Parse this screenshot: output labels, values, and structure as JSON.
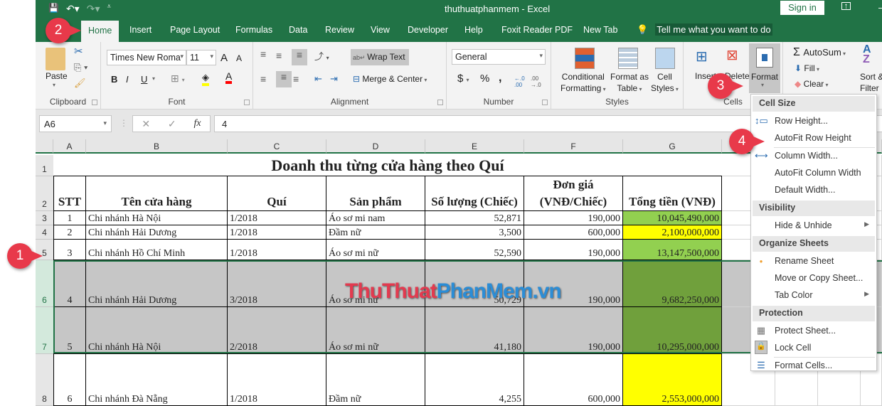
{
  "window": {
    "title": "thuthuatphanmem  -  Excel",
    "sign_in": "Sign in"
  },
  "qat": {
    "save": "💾",
    "undo": "↶▾",
    "redo": "↷▾",
    "customize": "⩡"
  },
  "tabs": [
    "Home",
    "Insert",
    "Page Layout",
    "Formulas",
    "Data",
    "Review",
    "View",
    "Developer",
    "Help",
    "Foxit Reader PDF",
    "New Tab"
  ],
  "tell_me": "Tell me what you want to do",
  "ribbon": {
    "clipboard": {
      "label": "Clipboard",
      "paste": "Paste"
    },
    "font": {
      "label": "Font",
      "font_name": "Times New Roma",
      "font_size": "11",
      "bold": "B",
      "italic": "I",
      "underline": "U",
      "grow": "A",
      "shrink": "A"
    },
    "alignment": {
      "label": "Alignment",
      "wrap_text": "Wrap Text",
      "merge_center": "Merge & Center"
    },
    "number": {
      "label": "Number",
      "format": "General",
      "currency": "$",
      "percent": "%",
      "comma": ",",
      "inc_dec": "←.0 .00",
      "dec_dec": ".00 →.0"
    },
    "styles": {
      "label": "Styles",
      "conditional": "Conditional",
      "conditional2": "Formatting",
      "format_table": "Format as",
      "format_table2": "Table",
      "cell_styles": "Cell",
      "cell_styles2": "Styles"
    },
    "cells": {
      "label": "Cells",
      "insert": "Insert",
      "delete": "Delete",
      "format": "Format"
    },
    "editing": {
      "autosum": "AutoSum",
      "fill": "Fill",
      "clear": "Clear",
      "sort": "Sort &",
      "filter": "Filter"
    }
  },
  "formula_bar": {
    "name_box": "A6",
    "fx": "fx",
    "value": "4"
  },
  "columns": [
    "A",
    "B",
    "C",
    "D",
    "E",
    "F",
    "G"
  ],
  "rows": [
    "1",
    "2",
    "3",
    "4",
    "5",
    "6",
    "7",
    "8"
  ],
  "sheet": {
    "title": "Doanh thu từng cửa hàng theo Quí",
    "headers": [
      "STT",
      "Tên cửa hàng",
      "Quí",
      "Sản phẩm",
      "Số lượng (Chiếc)",
      "Đơn giá (VNĐ/Chiếc)",
      "Tổng tiền (VNĐ)"
    ],
    "data": [
      [
        "1",
        "Chi nhánh Hà Nội",
        "1/2018",
        "Áo sơ mi nam",
        "52,871",
        "190,000",
        "10,045,490,000"
      ],
      [
        "2",
        "Chi nhánh Hải Dương",
        "1/2018",
        "Đầm nữ",
        "3,500",
        "600,000",
        "2,100,000,000"
      ],
      [
        "3",
        "Chi nhánh Hồ Chí Minh",
        "1/2018",
        "Áo sơ mi nữ",
        "52,590",
        "190,000",
        "13,147,500,000"
      ],
      [
        "4",
        "Chi nhánh Hải Dương",
        "3/2018",
        "Áo sơ mi nữ",
        "50,729",
        "190,000",
        "9,682,250,000"
      ],
      [
        "5",
        "Chi nhánh Hà Nội",
        "2/2018",
        "Áo sơ mi nữ",
        "41,180",
        "190,000",
        "10,295,000,000"
      ],
      [
        "6",
        "Chi nhánh Đà Nẵng",
        "1/2018",
        "Đầm nữ",
        "4,255",
        "600,000",
        "2,553,000,000"
      ]
    ],
    "total_colors": [
      "#92d050",
      "#ffff00",
      "#92d050",
      "#70a03c",
      "#70a03c",
      "#ffff00"
    ]
  },
  "format_menu": {
    "sections": [
      {
        "title": "Cell Size",
        "items": [
          {
            "label": "Row Height...",
            "icon": "row-height-icon"
          },
          {
            "label": "AutoFit Row Height",
            "icon": ""
          },
          {
            "label": "Column Width...",
            "icon": "column-width-icon"
          },
          {
            "label": "AutoFit Column Width",
            "icon": ""
          },
          {
            "label": "Default Width...",
            "icon": ""
          }
        ]
      },
      {
        "title": "Visibility",
        "items": [
          {
            "label": "Hide & Unhide",
            "icon": "",
            "submenu": true
          }
        ]
      },
      {
        "title": "Organize Sheets",
        "items": [
          {
            "label": "Rename Sheet",
            "icon": "dot-icon"
          },
          {
            "label": "Move or Copy Sheet...",
            "icon": ""
          },
          {
            "label": "Tab Color",
            "icon": "",
            "submenu": true
          }
        ]
      },
      {
        "title": "Protection",
        "items": [
          {
            "label": "Protect Sheet...",
            "icon": "protect-sheet-icon"
          },
          {
            "label": "Lock Cell",
            "icon": "lock-icon"
          },
          {
            "label": "Format Cells...",
            "icon": "format-cells-icon"
          }
        ]
      }
    ]
  },
  "annotations": [
    "1",
    "2",
    "3",
    "4"
  ],
  "watermark": {
    "part1": "ThuThuat",
    "part2": "PhanMem.vn"
  }
}
